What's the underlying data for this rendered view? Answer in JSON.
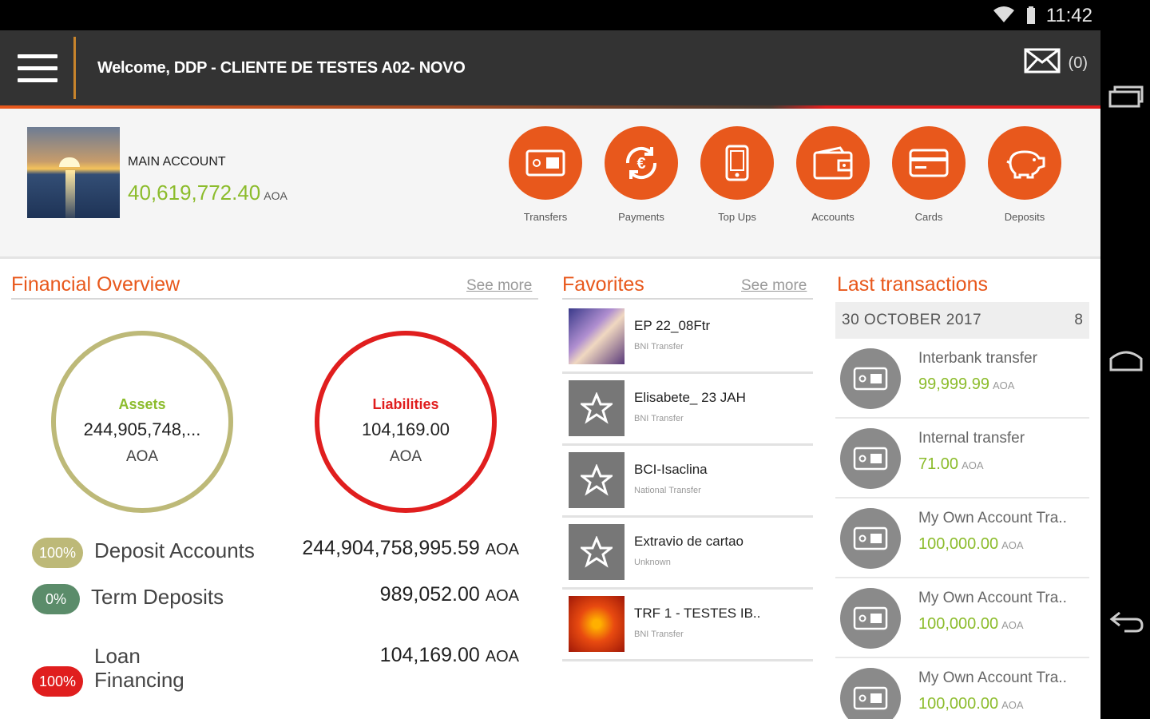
{
  "status_bar": {
    "time": "11:42"
  },
  "header": {
    "welcome": "Welcome, DDP - CLIENTE DE TESTES A02- NOVO",
    "mail_count": "(0)"
  },
  "account": {
    "label": "MAIN ACCOUNT",
    "balance": "40,619,772.40",
    "currency": "AOA"
  },
  "quick_actions": [
    {
      "label": "Transfers",
      "icon": "transfer-card-icon"
    },
    {
      "label": "Payments",
      "icon": "euro-refresh-icon"
    },
    {
      "label": "Top Ups",
      "icon": "phone-icon"
    },
    {
      "label": "Accounts",
      "icon": "wallet-icon"
    },
    {
      "label": "Cards",
      "icon": "card-icon"
    },
    {
      "label": "Deposits",
      "icon": "piggy-bank-icon"
    }
  ],
  "financial_overview": {
    "title": "Financial Overview",
    "see_more": "See more",
    "assets": {
      "label": "Assets",
      "value": "244,905,748,...",
      "currency": "AOA",
      "color": "#bdb978"
    },
    "liabilities": {
      "label": "Liabilities",
      "value": "104,169.00",
      "currency": "AOA",
      "color": "#e01e1e"
    },
    "rows": [
      {
        "pct": "100%",
        "name": "Deposit Accounts",
        "amount": "244,904,758,995.59",
        "currency": "AOA",
        "color": "#bdb978"
      },
      {
        "pct": "0%",
        "name": "Term Deposits",
        "amount": "989,052.00",
        "currency": "AOA",
        "color": "#5b8c6a"
      },
      {
        "pct": "100%",
        "name_line1": "Loan",
        "name_line2": "Financing",
        "amount": "104,169.00",
        "currency": "AOA",
        "color": "#e01e1e"
      }
    ]
  },
  "favorites": {
    "title": "Favorites",
    "see_more": "See more",
    "items": [
      {
        "name": "EP 22_08Ftr",
        "type": "BNI Transfer"
      },
      {
        "name": "Elisabete_ 23 JAH",
        "type": "BNI Transfer"
      },
      {
        "name": "BCI-Isaclina",
        "type": "National Transfer"
      },
      {
        "name": "Extravio de cartao",
        "type": "Unknown"
      },
      {
        "name": "TRF 1 - TESTES IB..",
        "type": "BNI Transfer"
      }
    ]
  },
  "transactions": {
    "title": "Last transactions",
    "date": "30 OCTOBER 2017",
    "count": "8",
    "items": [
      {
        "name": "Interbank transfer",
        "amount": "99,999.99",
        "currency": "AOA"
      },
      {
        "name": "Internal transfer",
        "amount": "71.00",
        "currency": "AOA"
      },
      {
        "name": "My Own Account Tra..",
        "amount": "100,000.00",
        "currency": "AOA"
      },
      {
        "name": "My Own Account Tra..",
        "amount": "100,000.00",
        "currency": "AOA"
      },
      {
        "name": "My Own Account Tra..",
        "amount": "100,000.00",
        "currency": "AOA"
      }
    ]
  }
}
